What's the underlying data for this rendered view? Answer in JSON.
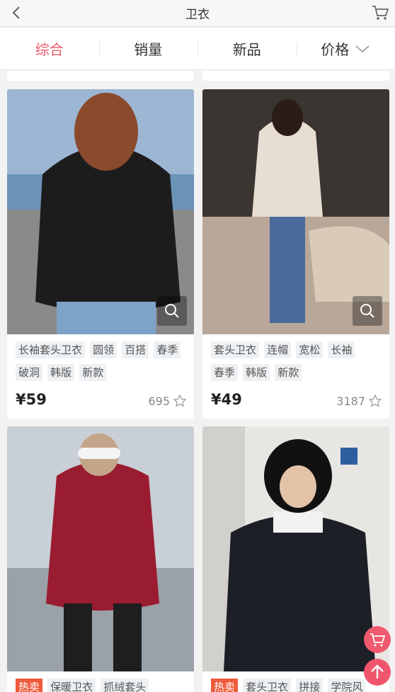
{
  "header": {
    "title": "卫衣",
    "back_icon": "chevron-left-icon",
    "cart_icon": "cart-icon"
  },
  "tabs": [
    {
      "label": "综合",
      "active": true
    },
    {
      "label": "销量",
      "active": false
    },
    {
      "label": "新品",
      "active": false
    },
    {
      "label": "价格",
      "active": false,
      "icon": "chevron-down-icon"
    }
  ],
  "products": [
    {
      "tags": [
        "长袖套头卫衣",
        "圆领",
        "百搭",
        "春季",
        "破洞",
        "韩版",
        "新款"
      ],
      "price": "¥59",
      "likes": "695"
    },
    {
      "tags": [
        "套头卫衣",
        "连帽",
        "宽松",
        "长袖",
        "春季",
        "韩版",
        "新款"
      ],
      "price": "¥49",
      "likes": "3187"
    },
    {
      "hot_label": "热卖",
      "tags": [
        "保暖卫衣",
        "抓绒套头"
      ],
      "price": "",
      "likes": ""
    },
    {
      "hot_label": "热卖",
      "tags": [
        "套头卫衣",
        "拼接",
        "学院风"
      ],
      "price": "",
      "likes": ""
    }
  ],
  "colors": {
    "accent": "#ee5a6c",
    "hot": "#ee5a3a"
  }
}
